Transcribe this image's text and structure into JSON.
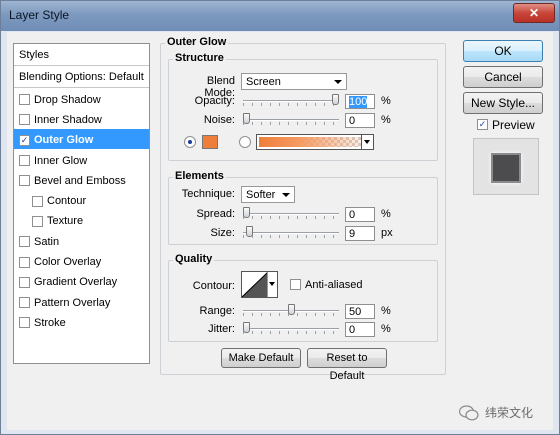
{
  "window": {
    "title": "Layer Style"
  },
  "sidebar": {
    "header": "Styles",
    "blending_options": "Blending Options: Default",
    "items": [
      {
        "label": "Drop Shadow",
        "checked": false,
        "sub": false,
        "selected": false
      },
      {
        "label": "Inner Shadow",
        "checked": false,
        "sub": false,
        "selected": false
      },
      {
        "label": "Outer Glow",
        "checked": true,
        "sub": false,
        "selected": true
      },
      {
        "label": "Inner Glow",
        "checked": false,
        "sub": false,
        "selected": false
      },
      {
        "label": "Bevel and Emboss",
        "checked": false,
        "sub": false,
        "selected": false
      },
      {
        "label": "Contour",
        "checked": false,
        "sub": true,
        "selected": false
      },
      {
        "label": "Texture",
        "checked": false,
        "sub": true,
        "selected": false
      },
      {
        "label": "Satin",
        "checked": false,
        "sub": false,
        "selected": false
      },
      {
        "label": "Color Overlay",
        "checked": false,
        "sub": false,
        "selected": false
      },
      {
        "label": "Gradient Overlay",
        "checked": false,
        "sub": false,
        "selected": false
      },
      {
        "label": "Pattern Overlay",
        "checked": false,
        "sub": false,
        "selected": false
      },
      {
        "label": "Stroke",
        "checked": false,
        "sub": false,
        "selected": false
      }
    ]
  },
  "outer_glow": {
    "title": "Outer Glow",
    "structure": {
      "title": "Structure",
      "blend_mode_label": "Blend Mode:",
      "blend_mode_value": "Screen",
      "opacity_label": "Opacity:",
      "opacity_value": "100",
      "opacity_unit": "%",
      "opacity_level": 1.0,
      "noise_label": "Noise:",
      "noise_value": "0",
      "noise_unit": "%",
      "noise_level": 0,
      "glow_color": "#ef7e3a"
    },
    "elements": {
      "title": "Elements",
      "technique_label": "Technique:",
      "technique_value": "Softer",
      "spread_label": "Spread:",
      "spread_value": "0",
      "spread_unit": "%",
      "spread_level": 0,
      "size_label": "Size:",
      "size_value": "9",
      "size_unit": "px",
      "size_level": 0.036
    },
    "quality": {
      "title": "Quality",
      "contour_label": "Contour:",
      "anti_aliased_label": "Anti-aliased",
      "anti_aliased_checked": false,
      "range_label": "Range:",
      "range_value": "50",
      "range_unit": "%",
      "range_level": 0.5,
      "jitter_label": "Jitter:",
      "jitter_value": "0",
      "jitter_unit": "%",
      "jitter_level": 0
    },
    "make_default": "Make Default",
    "reset_default": "Reset to Default"
  },
  "actions": {
    "ok": "OK",
    "cancel": "Cancel",
    "new_style": "New Style...",
    "preview_label": "Preview",
    "preview_checked": true
  },
  "watermark": {
    "text": "纬荣文化"
  },
  "colors": {
    "selection": "#3399ff",
    "accent": "#ef7e3a",
    "close": "#c9463a"
  }
}
